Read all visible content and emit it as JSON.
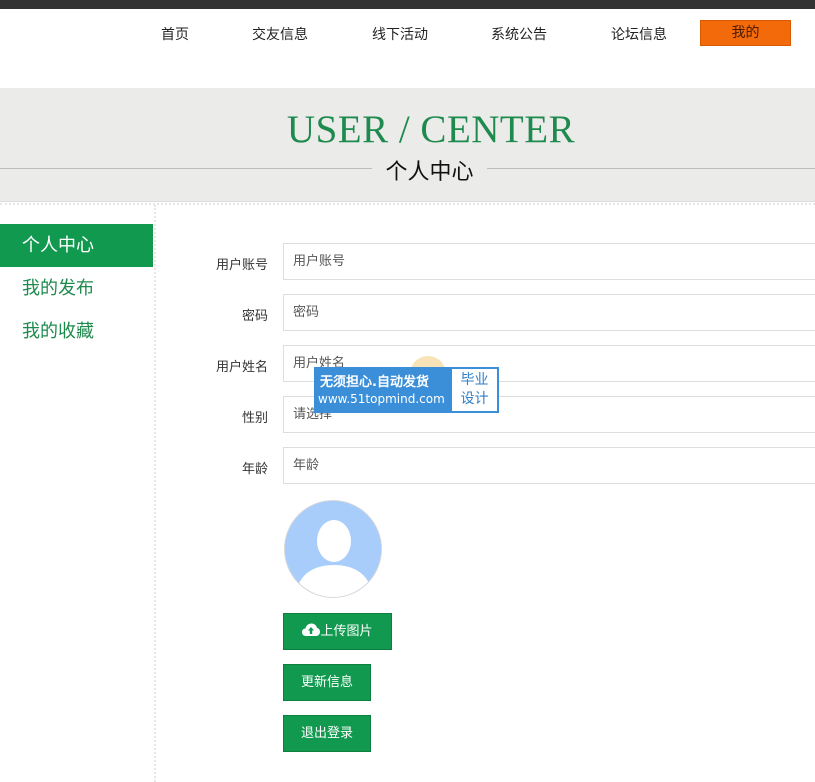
{
  "nav": {
    "items": [
      "首页",
      "交友信息",
      "线下活动",
      "系统公告",
      "论坛信息"
    ],
    "active": "我的"
  },
  "banner": {
    "title_en": "USER / CENTER",
    "title_cn": "个人中心"
  },
  "sidebar": {
    "items": [
      {
        "label": "个人中心",
        "active": true
      },
      {
        "label": "我的发布",
        "active": false
      },
      {
        "label": "我的收藏",
        "active": false
      }
    ]
  },
  "form": {
    "fields": [
      {
        "label": "用户账号",
        "value": "用户账号"
      },
      {
        "label": "密码",
        "value": "密码"
      },
      {
        "label": "用户姓名",
        "value": "用户姓名"
      },
      {
        "label": "性别",
        "value": "请选择"
      },
      {
        "label": "年龄",
        "value": "年龄"
      }
    ],
    "upload_label": "上传图片",
    "update_label": "更新信息",
    "logout_label": "退出登录"
  },
  "watermark": {
    "line1": "无须担心.自动发货",
    "line2": "www.51topmind.com",
    "side1": "毕业",
    "side2": "设计"
  },
  "colors": {
    "accent": "#119a4f",
    "nav_active": "#f26a0a",
    "banner_bg": "#ebebe9"
  }
}
